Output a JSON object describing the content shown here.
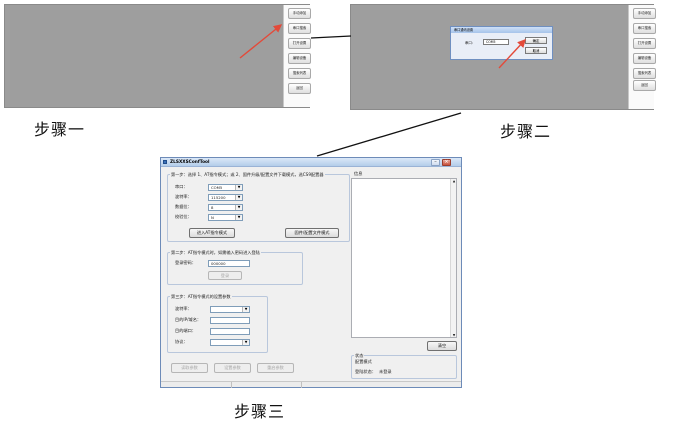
{
  "step1": {
    "caption": "步骤一",
    "sidebar_buttons": [
      "手动添加",
      "串口搜索",
      "打开设置",
      "编辑设备",
      "搜索列表",
      "返回"
    ]
  },
  "step2": {
    "caption": "步骤二",
    "sidebar_buttons": [
      "手动添加",
      "串口搜索",
      "打开设置",
      "编辑设备",
      "搜索列表",
      "返回"
    ],
    "dialog": {
      "title": "串口通讯设置",
      "port_label": "串口：",
      "port_value": "COM5",
      "ok_label": "确定",
      "cancel_label": "取消"
    }
  },
  "step3": {
    "caption": "步骤三",
    "window_title": "ZLSXXSConfTool",
    "group1": {
      "title": "第一步：选择 1、AT指令模式；或 2、固件升级/配置文件下载模式，选CS9配置器",
      "fields": [
        {
          "label": "串口：",
          "value": "COM5"
        },
        {
          "label": "波特率：",
          "value": "115200"
        },
        {
          "label": "数据位：",
          "value": "8"
        },
        {
          "label": "校验位：",
          "value": "N"
        }
      ],
      "at_button": "进入AT指令模式",
      "fw_button": "固件/配置文件模式"
    },
    "group2": {
      "title": "第二步：AT指令模式时，如需输入密码进入登陆",
      "pwd_label": "登录密码：",
      "pwd_value": "000000",
      "login_button": "登录"
    },
    "group3": {
      "title": "第三步：AT指令模式的设置参数",
      "fields": [
        {
          "label": "波特率：",
          "value": "",
          "kind": "combo"
        },
        {
          "label": "目的IP/域名：",
          "value": "",
          "kind": "input"
        },
        {
          "label": "目的端口：",
          "value": "",
          "kind": "input"
        },
        {
          "label": "协议：",
          "value": "",
          "kind": "combo"
        }
      ]
    },
    "bottom_buttons": [
      "读取参数",
      "设置参数",
      "重启参数"
    ],
    "info": {
      "title": "信息",
      "clear_button": "清空"
    },
    "status": {
      "title": "状态",
      "line1": "配置模式",
      "line2_label": "登陆状态：",
      "line2_value": "未登录"
    }
  }
}
